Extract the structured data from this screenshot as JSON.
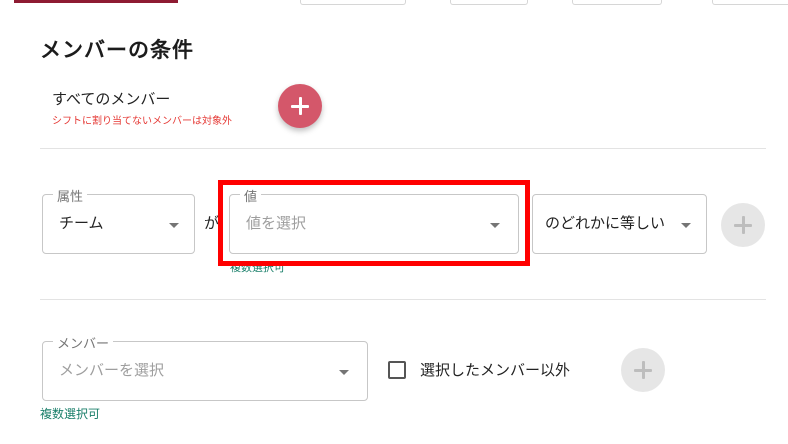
{
  "section_title": "メンバーの条件",
  "all_members": {
    "label": "すべてのメンバー",
    "warning": "シフトに割り当てないメンバーは対象外"
  },
  "attribute_filter": {
    "attribute_legend": "属性",
    "attribute_value": "チーム",
    "connector": "が",
    "value_legend": "値",
    "value_placeholder": "値を選択",
    "multi_select_hint": "複数選択可",
    "condition_value": "のどれかに等しい"
  },
  "member_filter": {
    "legend": "メンバー",
    "placeholder": "メンバーを選択",
    "multi_select_hint": "複数選択可",
    "exclude_label": "選択したメンバー以外",
    "exclude_checked": false
  },
  "icons": {
    "add": "plus-icon",
    "dropdown": "chevron-down-icon",
    "checkbox": "checkbox-icon"
  },
  "colors": {
    "primary_fab": "#d4576a",
    "warning_text": "#e53935",
    "hint_text": "#1a7f6a",
    "highlight": "#ff0000",
    "disabled_fab": "#e6e6e6"
  }
}
